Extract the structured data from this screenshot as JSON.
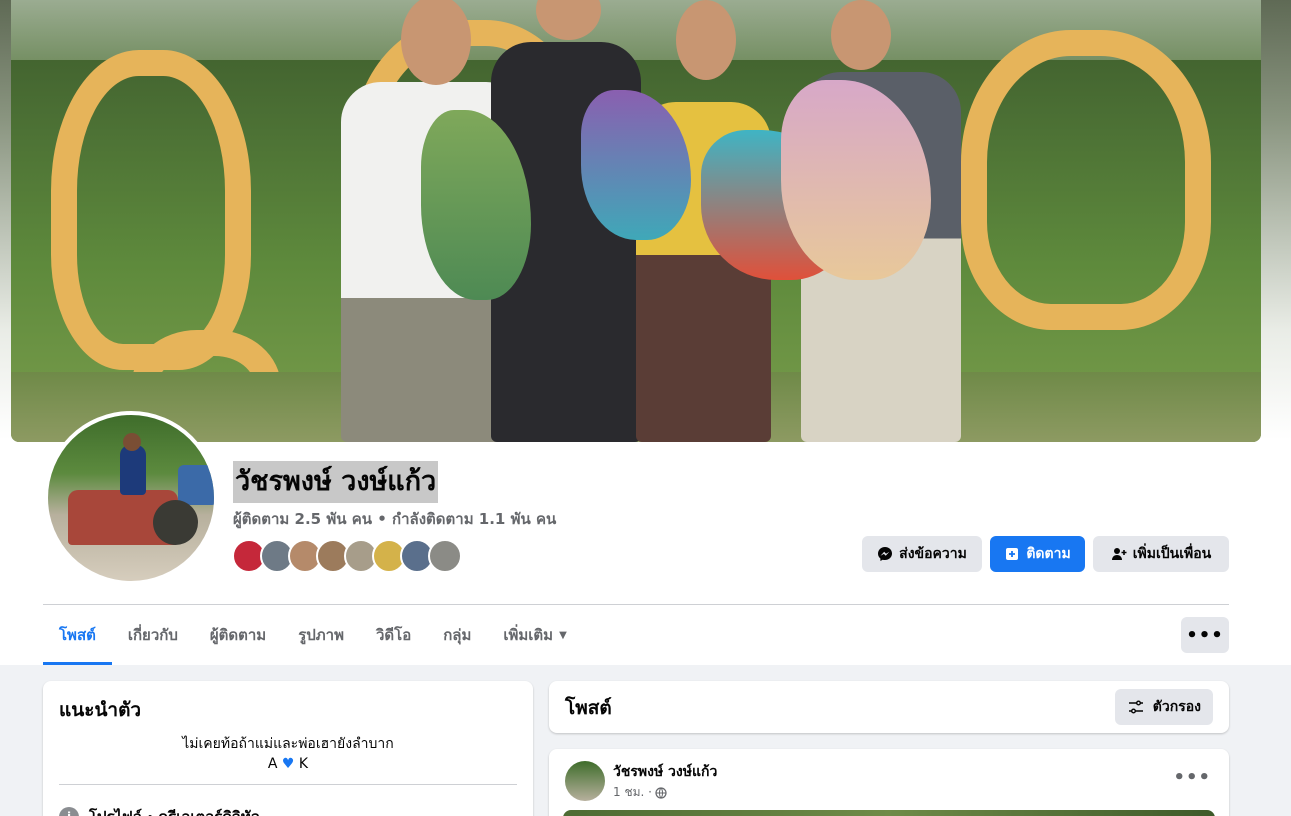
{
  "profile": {
    "name": "วัชรพงษ์ วงษ์แก้ว",
    "stats": "ผู้ติดตาม 2.5 พัน คน • กำลังติดตาม 1.1 พัน คน"
  },
  "actions": {
    "message_label": "ส่งข้อความ",
    "follow_label": "ติดตาม",
    "add_friend_label": "เพิ่มเป็นเพื่อน"
  },
  "tabs": [
    {
      "label": "โพสต์",
      "active": true
    },
    {
      "label": "เกี่ยวกับ"
    },
    {
      "label": "ผู้ติดตาม"
    },
    {
      "label": "รูปภาพ"
    },
    {
      "label": "วิดีโอ"
    },
    {
      "label": "กลุ่ม"
    },
    {
      "label": "เพิ่มเติม"
    }
  ],
  "more_label": "•••",
  "intro": {
    "title": "แนะนำตัว",
    "bio_line1": "ไม่เคยท้อถ้าแม่และพ่อเฮายังลำบาก",
    "bio_line2_a": "A",
    "bio_line2_b": "K",
    "info_text": "โปรไฟล์ · ครีเอเตอร์ดิจิทัล"
  },
  "posts": {
    "title": "โพสต์",
    "filter_label": "ตัวกรอง"
  },
  "post": {
    "author": "วัชรพงษ์ วงษ์แก้ว",
    "time": "1 ชม. ·",
    "menu": "•••"
  },
  "colors": {
    "accent": "#1877f2",
    "background": "#f0f2f5",
    "button_grey": "#e4e6eb"
  }
}
